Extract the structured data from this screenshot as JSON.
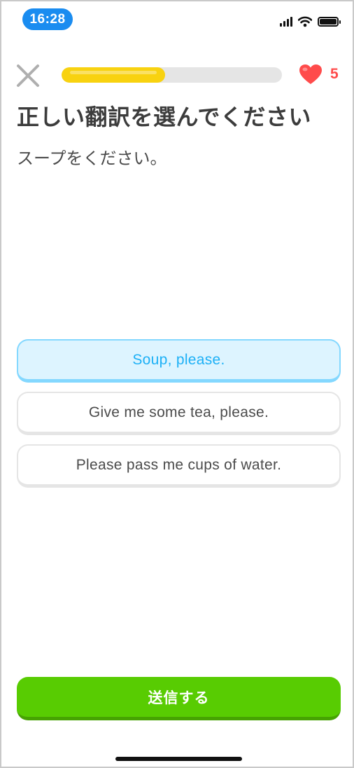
{
  "status_bar": {
    "time": "16:28"
  },
  "header": {
    "close_icon": "close-icon",
    "progress_fraction": 0.47,
    "progress_color": "#f8d210",
    "hearts_icon": "heart-icon",
    "hearts_count": "5"
  },
  "question": {
    "title": "正しい翻訳を選んでください",
    "prompt": "スープをください。"
  },
  "options": [
    {
      "label": "Soup, please.",
      "selected": true
    },
    {
      "label": "Give me some tea, please.",
      "selected": false
    },
    {
      "label": "Please pass me cups of water.",
      "selected": false
    }
  ],
  "footer": {
    "submit_label": "送信する",
    "submit_color": "#58cc02"
  }
}
